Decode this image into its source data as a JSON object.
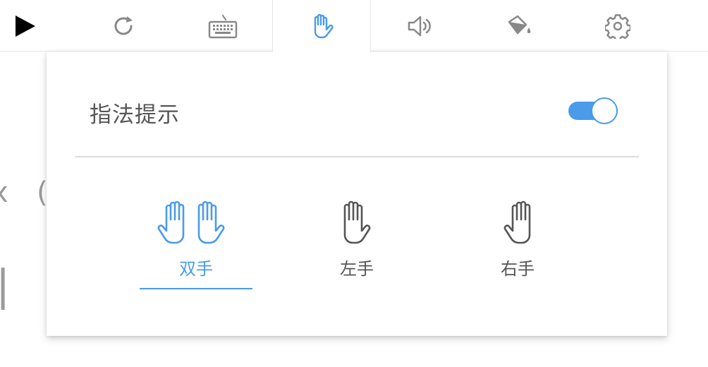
{
  "toolbar": {
    "tools": [
      {
        "name": "play",
        "icon": "play-icon"
      },
      {
        "name": "restart",
        "icon": "refresh-icon"
      },
      {
        "name": "keyboard",
        "icon": "keyboard-icon"
      },
      {
        "name": "finger-hint",
        "icon": "hand-icon",
        "active": true
      },
      {
        "name": "sound",
        "icon": "speaker-icon"
      },
      {
        "name": "theme",
        "icon": "paint-bucket-icon"
      },
      {
        "name": "settings",
        "icon": "gear-icon"
      }
    ],
    "active_color": "#4a9bea"
  },
  "popup": {
    "title": "指法提示",
    "toggle_on": true,
    "options": [
      {
        "label": "双手",
        "icon": "both-hands-icon",
        "selected": true
      },
      {
        "label": "左手",
        "icon": "left-hand-icon",
        "selected": false
      },
      {
        "label": "右手",
        "icon": "right-hand-icon",
        "selected": false
      }
    ]
  },
  "colors": {
    "accent": "#4a9bea",
    "text": "#555555",
    "icon": "#888888"
  }
}
